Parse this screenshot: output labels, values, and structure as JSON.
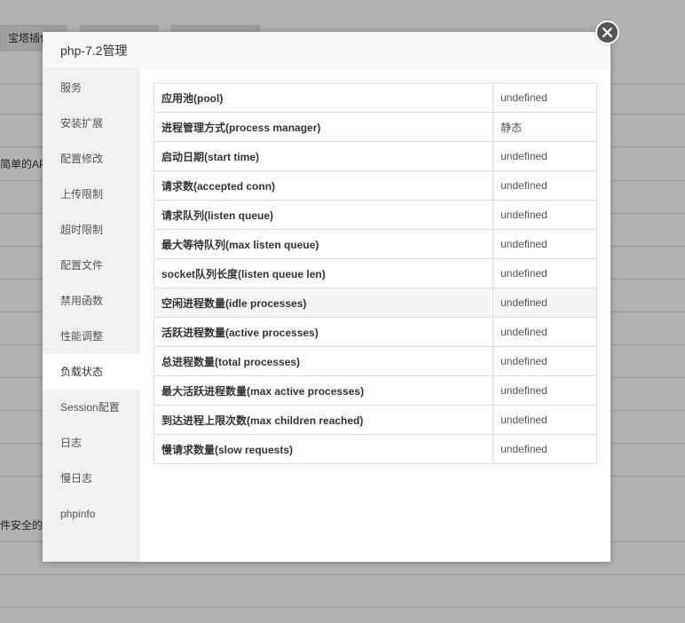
{
  "background": {
    "tabs": [
      "宝塔插件",
      "",
      ""
    ],
    "texts": [
      "简单的API",
      "件安全的免"
    ]
  },
  "dialog": {
    "title": "php-7.2管理",
    "sidebar": {
      "items": [
        {
          "label": "服务"
        },
        {
          "label": "安装扩展"
        },
        {
          "label": "配置修改"
        },
        {
          "label": "上传限制"
        },
        {
          "label": "超时限制"
        },
        {
          "label": "配置文件"
        },
        {
          "label": "禁用函数"
        },
        {
          "label": "性能调整"
        },
        {
          "label": "负载状态"
        },
        {
          "label": "Session配置"
        },
        {
          "label": "日志"
        },
        {
          "label": "慢日志"
        },
        {
          "label": "phpinfo"
        }
      ],
      "active": "负载状态"
    },
    "table": {
      "rows": [
        {
          "key": "应用池(pool)",
          "value": "undefined"
        },
        {
          "key": "进程管理方式(process manager)",
          "value": "静态"
        },
        {
          "key": "启动日期(start time)",
          "value": "undefined"
        },
        {
          "key": "请求数(accepted conn)",
          "value": "undefined"
        },
        {
          "key": "请求队列(listen queue)",
          "value": "undefined"
        },
        {
          "key": "最大等待队列(max listen queue)",
          "value": "undefined"
        },
        {
          "key": "socket队列长度(listen queue len)",
          "value": "undefined"
        },
        {
          "key": "空闲进程数量(idle processes)",
          "value": "undefined"
        },
        {
          "key": "活跃进程数量(active processes)",
          "value": "undefined"
        },
        {
          "key": "总进程数量(total processes)",
          "value": "undefined"
        },
        {
          "key": "最大活跃进程数量(max active processes)",
          "value": "undefined"
        },
        {
          "key": "到达进程上限次数(max children reached)",
          "value": "undefined"
        },
        {
          "key": "慢请求数量(slow requests)",
          "value": "undefined"
        }
      ]
    },
    "close_icon": "close-icon",
    "colors": {
      "overlay": "#000000",
      "close_button": "#555555",
      "sidebar_bg": "#f0f0f0",
      "header_bg": "#f8f8f8"
    }
  }
}
